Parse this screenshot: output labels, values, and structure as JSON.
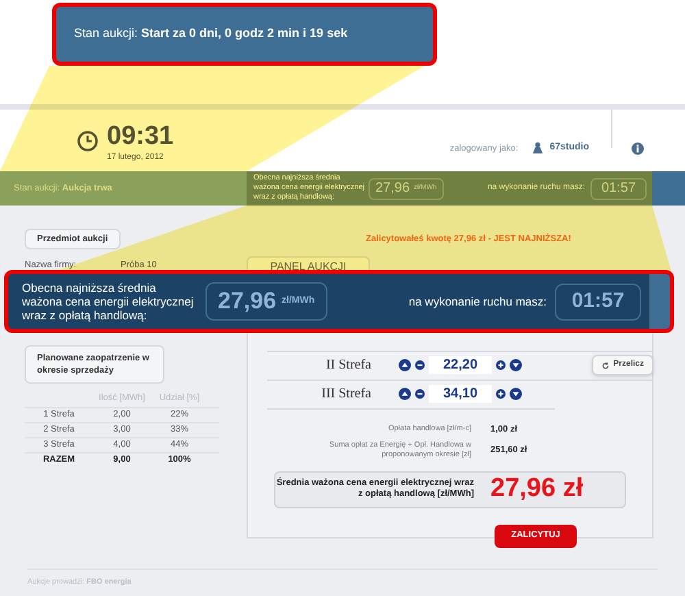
{
  "header": {
    "time": "09:31",
    "date": "17 lutego, 2012",
    "logged_label": "zalogowany jako:",
    "user": "67studio"
  },
  "status_bar": {
    "auction_state": "Stan aukcji: **Aukcja trwa**",
    "price_label": "Obecna najniższa średnia ważona cena energii elektrycznej wraz z opłatą handlową:",
    "price": "27,96",
    "unit": "zł/MWh",
    "timer_label": "na wykonanie ruchu masz:",
    "timer": "01:57"
  },
  "message": "Zalicytowałeś kwotę 27,96 zł - JEST NAJNIŻSZA!",
  "subject": {
    "heading": "Przedmiot aukcji",
    "company_label": "Nazwa firmy:",
    "company": "Próba 10"
  },
  "planned": {
    "heading": "Planowane zaopatrzenie w okresie sprzedaży",
    "columns": [
      "",
      "Ilość [MWh]",
      "Udział [%]"
    ],
    "rows": [
      {
        "kind": "zone",
        "cells": [
          "1 Strefa",
          "2,00",
          "22%"
        ]
      },
      {
        "kind": "zone",
        "cells": [
          "2 Strefa",
          "3,00",
          "33%"
        ]
      },
      {
        "kind": "zone",
        "cells": [
          "3 Strefa",
          "4,00",
          "44%"
        ]
      },
      {
        "kind": "total",
        "cells": [
          "RAZEM",
          "9,00",
          "100%"
        ]
      }
    ]
  },
  "panel": {
    "tab": "PANEL AUKCJI",
    "zones": [
      {
        "name": "II Strefa",
        "value": "22,20"
      },
      {
        "name": "III Strefa",
        "value": "34,10"
      }
    ],
    "recalc_button": "Przelicz",
    "fees": [
      {
        "label": "Opłata handlowa [zł/m-c]",
        "value": "1,00 zł"
      },
      {
        "label": "Suma opłat za Energię + Opł. Handlowa w proponowanym okresie [zł]",
        "value": "251,60 zł"
      }
    ],
    "result": {
      "label": "Średnia ważona cena energii elektrycznej wraz z opłatą handlową [zł/MWh]",
      "value": "27,96 zł"
    },
    "bid_button": "ZALICYTUJ"
  },
  "footer": "Aukcje prowadzi: **FBO energia**",
  "callouts": [
    {
      "kind": "status",
      "text": "Stan aukcji: **Start za 0 dni, 0 godz 2 min i 19 sek**"
    },
    {
      "kind": "price",
      "label": "Obecna najniższa średnia ważona cena energii elektrycznej wraz z opłatą handlową:",
      "price": "27,96",
      "unit": "zł/MWh",
      "timer_label": "na wykonanie ruchu masz:",
      "timer": "01:57"
    }
  ]
}
